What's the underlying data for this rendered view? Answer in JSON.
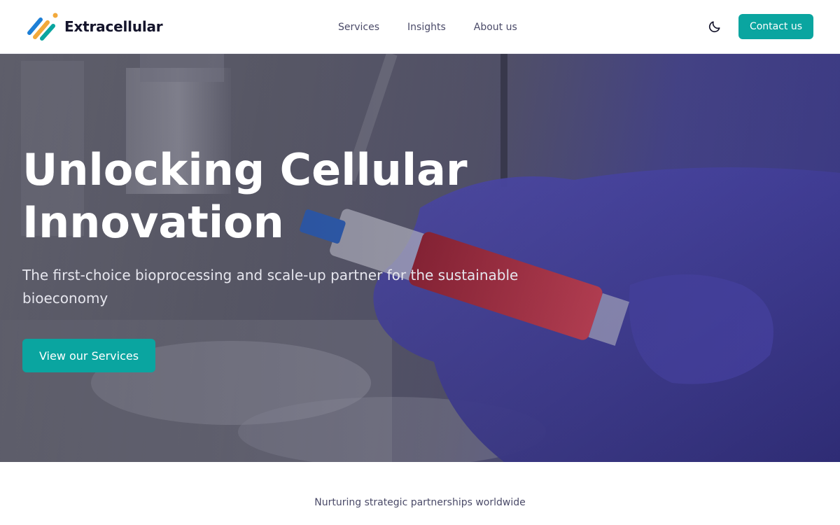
{
  "brand": {
    "name": "Extracellular",
    "logo_icon": "extracellular-logo-icon",
    "accent": "#0aa5a0"
  },
  "nav": {
    "items": [
      {
        "label": "Services"
      },
      {
        "label": "Insights"
      },
      {
        "label": "About us"
      }
    ],
    "theme_icon": "moon-icon",
    "contact_label": "Contact us"
  },
  "hero": {
    "title": "Unlocking Cellular Innovation",
    "subtitle": "The first-choice bioprocessing and scale-up partner for the sustainable bioeconomy",
    "cta_label": "View our Services",
    "background": "lab-photo-gloved-hand-syringe"
  },
  "partners": {
    "caption": "Nurturing strategic partnerships worldwide"
  }
}
